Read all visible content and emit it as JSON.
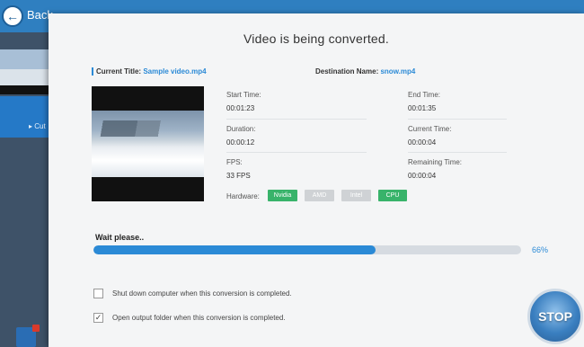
{
  "app": {
    "back_label": "Back"
  },
  "sidebar": {
    "item_label": "▸ Cut"
  },
  "dialog": {
    "title": "Video is being converted.",
    "current_title_label": "Current Title:",
    "current_title_value": "Sample video.mp4",
    "destination_label": "Destination Name:",
    "destination_value": "snow.mp4",
    "stats": {
      "start_time": {
        "label": "Start Time:",
        "value": "00:01:23"
      },
      "end_time": {
        "label": "End Time:",
        "value": "00:01:35"
      },
      "duration": {
        "label": "Duration:",
        "value": "00:00:12"
      },
      "current_time": {
        "label": "Current Time:",
        "value": "00:00:04"
      },
      "fps": {
        "label": "FPS:",
        "value": "33 FPS"
      },
      "remaining_time": {
        "label": "Remaining Time:",
        "value": "00:00:04"
      }
    },
    "hardware": {
      "label": "Hardware:",
      "options": [
        {
          "name": "Nvidia",
          "enabled": true
        },
        {
          "name": "AMD",
          "enabled": false
        },
        {
          "name": "Intel",
          "enabled": false
        },
        {
          "name": "CPU",
          "enabled": true
        }
      ]
    },
    "progress": {
      "status": "Wait please..",
      "percent": 66,
      "percent_label": "66%"
    },
    "options": [
      {
        "label": "Shut down computer when this conversion is completed.",
        "checked": false
      },
      {
        "label": "Open output folder when this conversion is completed.",
        "checked": true
      }
    ],
    "stop_label": "STOP"
  },
  "colors": {
    "accent": "#2b8ad6",
    "hardware_on": "#38b36a",
    "hardware_off": "#cfd2d5"
  }
}
